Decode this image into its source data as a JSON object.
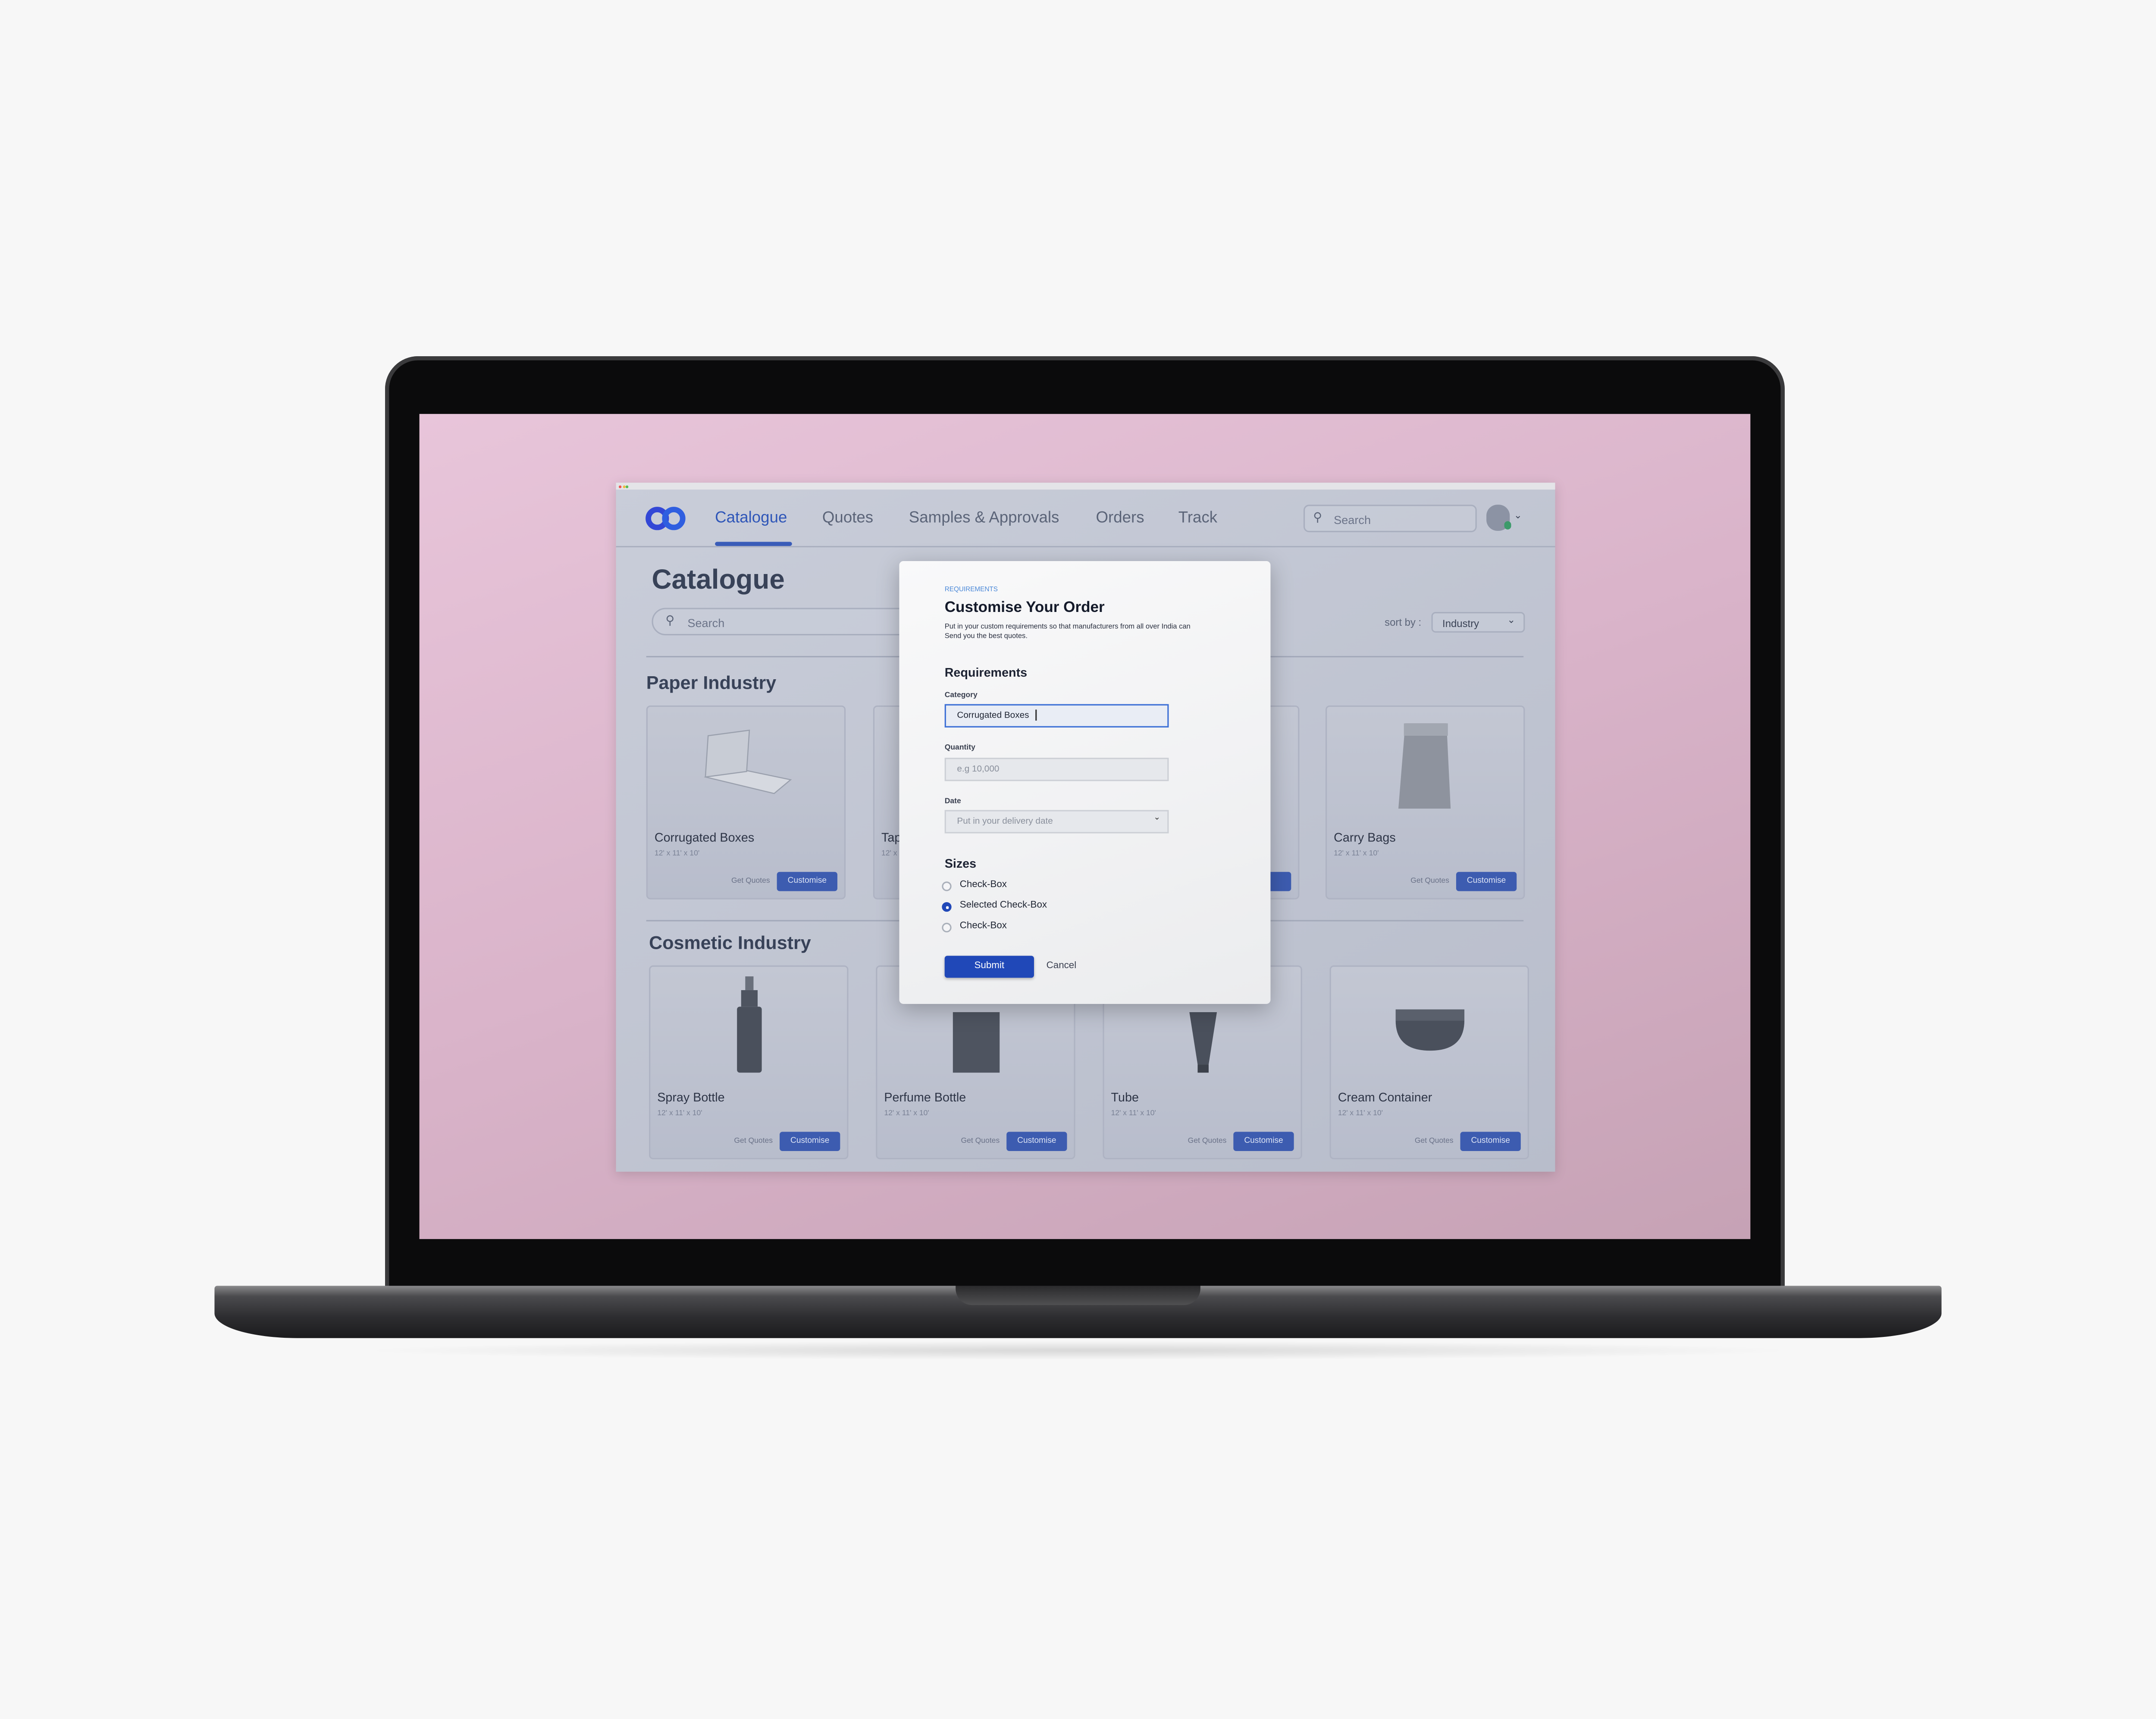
{
  "nav": {
    "tabs": [
      {
        "label": "Catalogue",
        "active": true
      },
      {
        "label": "Quotes"
      },
      {
        "label": "Samples & Approvals"
      },
      {
        "label": "Orders"
      },
      {
        "label": "Track"
      }
    ],
    "search_placeholder": "Search"
  },
  "page": {
    "title": "Catalogue",
    "search_placeholder": "Search",
    "sort_label": "sort by :",
    "sort_value": "Industry"
  },
  "sections": [
    {
      "title": "Paper Industry",
      "cards": [
        {
          "name": "Corrugated Boxes",
          "size": "12' x 11' x 10'",
          "quote": "Get Quotes",
          "customise": "Customise"
        },
        {
          "name": "Tap",
          "size": "12' x",
          "quote": "",
          "customise": ""
        },
        {
          "name": "",
          "size": "",
          "quote": "",
          "customise": "se"
        },
        {
          "name": "Carry Bags",
          "size": "12' x 11' x 10'",
          "quote": "Get Quotes",
          "customise": "Customise"
        }
      ]
    },
    {
      "title": "Cosmetic Industry",
      "cards": [
        {
          "name": "Spray Bottle",
          "size": "12' x 11' x 10'",
          "quote": "Get Quotes",
          "customise": "Customise"
        },
        {
          "name": "Perfume Bottle",
          "size": "12' x 11' x 10'",
          "quote": "Get Quotes",
          "customise": "Customise"
        },
        {
          "name": "Tube",
          "size": "12' x 11' x 10'",
          "quote": "Get Quotes",
          "customise": "Customise"
        },
        {
          "name": "Cream Container",
          "size": "12' x 11' x 10'",
          "quote": "Get Quotes",
          "customise": "Customise"
        }
      ]
    }
  ],
  "modal": {
    "eyebrow": "REQUIREMENTS",
    "title": "Customise Your Order",
    "description_1": "Put in your custom requirements so that manufacturers from all over India can",
    "description_2": "Send you the best quotes.",
    "section": "Requirements",
    "category_label": "Category",
    "category_value": "Corrugated Boxes",
    "quantity_label": "Quantity",
    "quantity_placeholder": "e.g 10,000",
    "date_label": "Date",
    "date_placeholder": "Put in your delivery date",
    "sizes_title": "Sizes",
    "sizes": [
      {
        "label": "Check-Box",
        "selected": false
      },
      {
        "label": "Selected Check-Box",
        "selected": true
      },
      {
        "label": "Check-Box",
        "selected": false
      }
    ],
    "submit": "Submit",
    "cancel": "Cancel"
  },
  "colors": {
    "accent": "#2048b8",
    "screen_bg": "#d9b3c9"
  }
}
